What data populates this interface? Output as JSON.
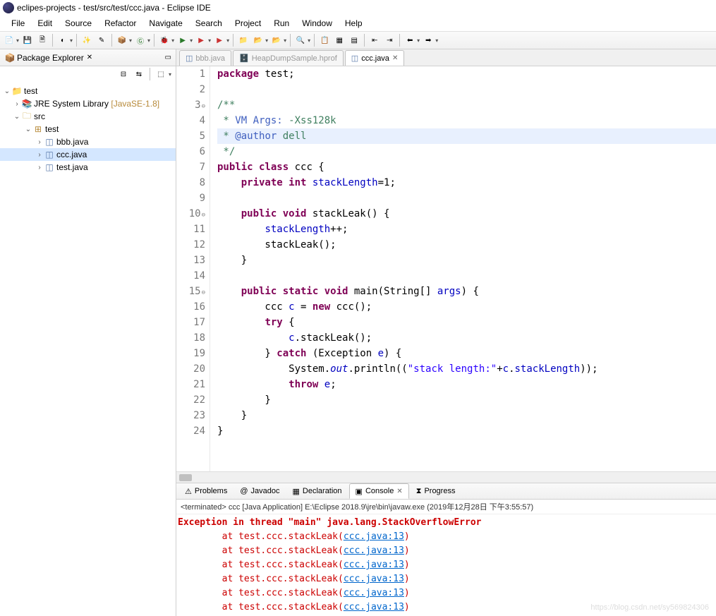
{
  "window": {
    "title": "eclipes-projects - test/src/test/ccc.java - Eclipse IDE"
  },
  "menu": [
    "File",
    "Edit",
    "Source",
    "Refactor",
    "Navigate",
    "Search",
    "Project",
    "Run",
    "Window",
    "Help"
  ],
  "sidebar": {
    "title": "Package Explorer",
    "tree": {
      "project": "test",
      "jre": "JRE System Library",
      "jre_decor": "[JavaSE-1.8]",
      "src": "src",
      "pkg": "test",
      "files": [
        "bbb.java",
        "ccc.java",
        "test.java"
      ]
    }
  },
  "editor_tabs": [
    {
      "label": "bbb.java",
      "active": false,
      "dim": true,
      "icon": "java"
    },
    {
      "label": "HeapDumpSample.hprof",
      "active": false,
      "dim": true,
      "icon": "hprof"
    },
    {
      "label": "ccc.java",
      "active": true,
      "dim": false,
      "icon": "java"
    }
  ],
  "code": {
    "lines": [
      {
        "n": "1",
        "fold": false,
        "hl": false,
        "tokens": [
          [
            "kw",
            "package"
          ],
          [
            "",
            " test;"
          ]
        ]
      },
      {
        "n": "2",
        "fold": false,
        "hl": false,
        "tokens": [
          [
            "",
            ""
          ]
        ]
      },
      {
        "n": "3",
        "fold": true,
        "hl": false,
        "tokens": [
          [
            "cm",
            "/**"
          ]
        ]
      },
      {
        "n": "4",
        "fold": false,
        "hl": false,
        "tokens": [
          [
            "cm",
            " * "
          ],
          [
            "cmtag",
            "VM Args:"
          ],
          [
            "cm",
            " -Xss128k"
          ]
        ]
      },
      {
        "n": "5",
        "fold": false,
        "hl": true,
        "tokens": [
          [
            "cm",
            " * "
          ],
          [
            "cmtag",
            "@author"
          ],
          [
            "cm",
            " dell"
          ]
        ]
      },
      {
        "n": "6",
        "fold": false,
        "hl": false,
        "tokens": [
          [
            "cm",
            " */"
          ]
        ]
      },
      {
        "n": "7",
        "fold": false,
        "hl": false,
        "tokens": [
          [
            "kw",
            "public class"
          ],
          [
            "",
            " ccc {"
          ]
        ]
      },
      {
        "n": "8",
        "fold": false,
        "hl": false,
        "tokens": [
          [
            "",
            "    "
          ],
          [
            "kw",
            "private int"
          ],
          [
            "",
            " "
          ],
          [
            "fld",
            "stackLength"
          ],
          [
            "",
            "=1;"
          ]
        ]
      },
      {
        "n": "9",
        "fold": false,
        "hl": false,
        "tokens": [
          [
            "",
            ""
          ]
        ]
      },
      {
        "n": "10",
        "fold": true,
        "hl": false,
        "tokens": [
          [
            "",
            "    "
          ],
          [
            "kw",
            "public void"
          ],
          [
            "",
            " stackLeak() {"
          ]
        ]
      },
      {
        "n": "11",
        "fold": false,
        "hl": false,
        "tokens": [
          [
            "",
            "        "
          ],
          [
            "fld",
            "stackLength"
          ],
          [
            "",
            "++;"
          ]
        ]
      },
      {
        "n": "12",
        "fold": false,
        "hl": false,
        "tokens": [
          [
            "",
            "        stackLeak();"
          ]
        ]
      },
      {
        "n": "13",
        "fold": false,
        "hl": false,
        "tokens": [
          [
            "",
            "    }"
          ]
        ]
      },
      {
        "n": "14",
        "fold": false,
        "hl": false,
        "tokens": [
          [
            "",
            ""
          ]
        ]
      },
      {
        "n": "15",
        "fold": true,
        "hl": false,
        "tokens": [
          [
            "",
            "    "
          ],
          [
            "kw",
            "public static void"
          ],
          [
            "",
            " main(String[] "
          ],
          [
            "fld",
            "args"
          ],
          [
            "",
            ") {"
          ]
        ]
      },
      {
        "n": "16",
        "fold": false,
        "hl": false,
        "tokens": [
          [
            "",
            "        ccc "
          ],
          [
            "fld",
            "c"
          ],
          [
            "",
            " = "
          ],
          [
            "kw",
            "new"
          ],
          [
            "",
            " ccc();"
          ]
        ]
      },
      {
        "n": "17",
        "fold": false,
        "hl": false,
        "tokens": [
          [
            "",
            "        "
          ],
          [
            "kw",
            "try"
          ],
          [
            "",
            " {"
          ]
        ]
      },
      {
        "n": "18",
        "fold": false,
        "hl": false,
        "tokens": [
          [
            "",
            "            "
          ],
          [
            "fld",
            "c"
          ],
          [
            "",
            ".stackLeak();"
          ]
        ]
      },
      {
        "n": "19",
        "fold": false,
        "hl": false,
        "tokens": [
          [
            "",
            "        } "
          ],
          [
            "kw",
            "catch"
          ],
          [
            "",
            " (Exception "
          ],
          [
            "fld",
            "e"
          ],
          [
            "",
            ") {"
          ]
        ]
      },
      {
        "n": "20",
        "fold": false,
        "hl": false,
        "tokens": [
          [
            "",
            "            System."
          ],
          [
            "sfld",
            "out"
          ],
          [
            "",
            ".println(("
          ],
          [
            "str",
            "\"stack length:\""
          ],
          [
            "",
            "+"
          ],
          [
            "fld",
            "c"
          ],
          [
            "",
            "."
          ],
          [
            "fld",
            "stackLength"
          ],
          [
            "",
            "));"
          ]
        ]
      },
      {
        "n": "21",
        "fold": false,
        "hl": false,
        "tokens": [
          [
            "",
            "            "
          ],
          [
            "kw",
            "throw"
          ],
          [
            "",
            " "
          ],
          [
            "fld",
            "e"
          ],
          [
            "",
            ";"
          ]
        ]
      },
      {
        "n": "22",
        "fold": false,
        "hl": false,
        "tokens": [
          [
            "",
            "        }"
          ]
        ]
      },
      {
        "n": "23",
        "fold": false,
        "hl": false,
        "tokens": [
          [
            "",
            "    }"
          ]
        ]
      },
      {
        "n": "24",
        "fold": false,
        "hl": false,
        "tokens": [
          [
            "",
            "}"
          ]
        ]
      }
    ]
  },
  "bottom_tabs": [
    {
      "label": "Problems",
      "icon": "problems"
    },
    {
      "label": "Javadoc",
      "icon": "javadoc"
    },
    {
      "label": "Declaration",
      "icon": "decl"
    },
    {
      "label": "Console",
      "icon": "console",
      "active": true
    },
    {
      "label": "Progress",
      "icon": "progress"
    }
  ],
  "console": {
    "info": "<terminated> ccc [Java Application] E:\\Eclipse 2018.9\\jre\\bin\\javaw.exe (2019年12月28日 下午3:55:57)",
    "header": "Exception in thread \"main\" java.lang.StackOverflowError",
    "frame_prefix": "        at test.ccc.stackLeak(",
    "frame_link": "ccc.java:13",
    "frame_suffix": ")",
    "frame_count": 6
  },
  "watermark": "https://blog.csdn.net/sy569824306"
}
